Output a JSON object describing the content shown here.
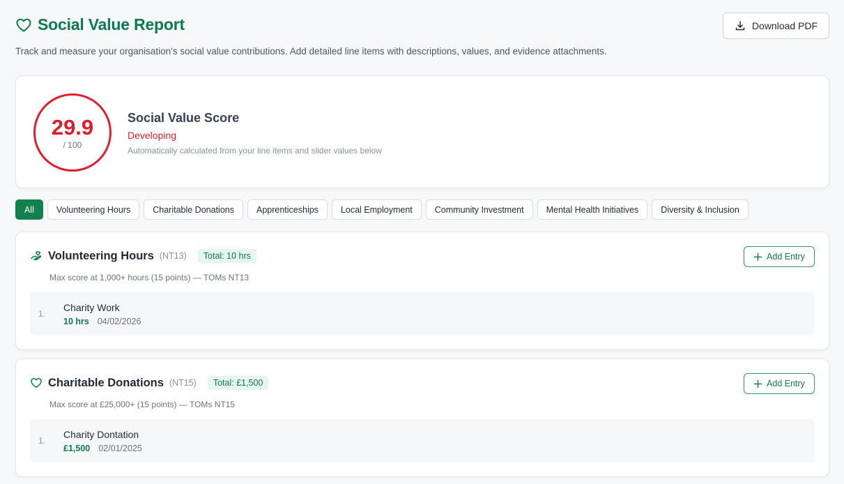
{
  "header": {
    "title": "Social Value Report",
    "subtitle": "Track and measure your organisation's social value contributions. Add detailed line items with descriptions, values, and evidence attachments.",
    "download_label": "Download PDF"
  },
  "score": {
    "value": "29.9",
    "max": "/ 100",
    "title": "Social Value Score",
    "status": "Developing",
    "description": "Automatically calculated from your line items and slider values below"
  },
  "filters": [
    "All",
    "Volunteering Hours",
    "Charitable Donations",
    "Apprenticeships",
    "Local Employment",
    "Community Investment",
    "Mental Health Initiatives",
    "Diversity & Inclusion"
  ],
  "sections": [
    {
      "title": "Volunteering Hours",
      "code": "(NT13)",
      "total": "Total: 10 hrs",
      "note": "Max score at 1,000+ hours (15 points) — TOMs NT13",
      "add_label": "Add Entry",
      "icon": "hand-heart-icon",
      "items": [
        {
          "num": "1.",
          "name": "Charity Work",
          "value": "10 hrs",
          "date": "04/02/2026"
        }
      ]
    },
    {
      "title": "Charitable Donations",
      "code": "(NT15)",
      "total": "Total: £1,500",
      "note": "Max score at £25,000+ (15 points) — TOMs NT15",
      "add_label": "Add Entry",
      "icon": "heart-icon",
      "items": [
        {
          "num": "1.",
          "name": "Charity Dontation",
          "value": "£1,500",
          "date": "02/01/2025"
        }
      ]
    }
  ],
  "colors": {
    "brand": "#0c7a4f",
    "score_status": "#dc1c2e",
    "active_chip": "#13804f"
  }
}
